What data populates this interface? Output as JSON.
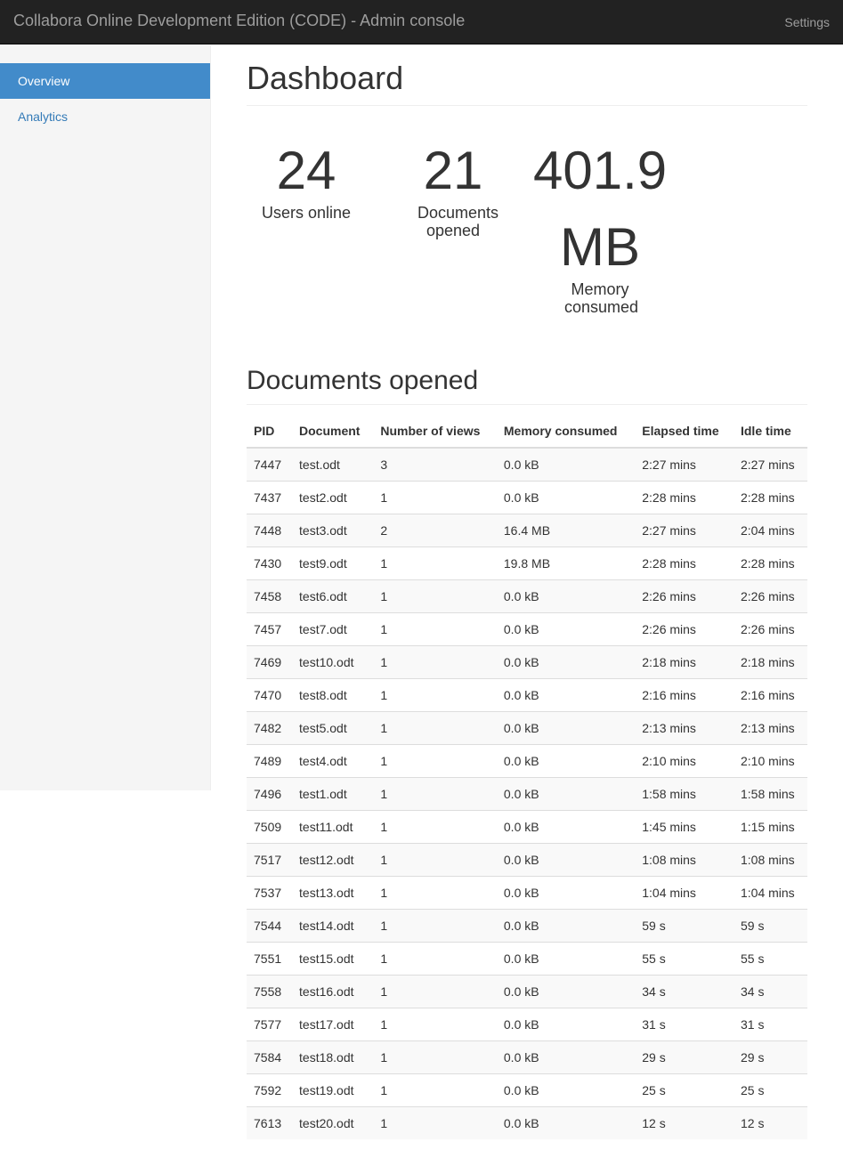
{
  "navbar": {
    "brand": "Collabora Online Development Edition (CODE) - Admin console",
    "settings": "Settings"
  },
  "sidebar": {
    "items": [
      {
        "label": "Overview",
        "active": true
      },
      {
        "label": "Analytics",
        "active": false
      }
    ]
  },
  "dashboard": {
    "title": "Dashboard",
    "stats": {
      "users_online": {
        "value": "24",
        "label": "Users online"
      },
      "documents_opened": {
        "value": "21",
        "label": "Documents opened"
      },
      "memory_consumed": {
        "value": "401.9 MB",
        "label": "Memory consumed"
      }
    }
  },
  "documents": {
    "title": "Documents opened",
    "columns": [
      "PID",
      "Document",
      "Number of views",
      "Memory consumed",
      "Elapsed time",
      "Idle time"
    ],
    "rows": [
      [
        "7447",
        "test.odt",
        "3",
        "0.0 kB",
        "2:27 mins",
        "2:27 mins"
      ],
      [
        "7437",
        "test2.odt",
        "1",
        "0.0 kB",
        "2:28 mins",
        "2:28 mins"
      ],
      [
        "7448",
        "test3.odt",
        "2",
        "16.4 MB",
        "2:27 mins",
        "2:04 mins"
      ],
      [
        "7430",
        "test9.odt",
        "1",
        "19.8 MB",
        "2:28 mins",
        "2:28 mins"
      ],
      [
        "7458",
        "test6.odt",
        "1",
        "0.0 kB",
        "2:26 mins",
        "2:26 mins"
      ],
      [
        "7457",
        "test7.odt",
        "1",
        "0.0 kB",
        "2:26 mins",
        "2:26 mins"
      ],
      [
        "7469",
        "test10.odt",
        "1",
        "0.0 kB",
        "2:18 mins",
        "2:18 mins"
      ],
      [
        "7470",
        "test8.odt",
        "1",
        "0.0 kB",
        "2:16 mins",
        "2:16 mins"
      ],
      [
        "7482",
        "test5.odt",
        "1",
        "0.0 kB",
        "2:13 mins",
        "2:13 mins"
      ],
      [
        "7489",
        "test4.odt",
        "1",
        "0.0 kB",
        "2:10 mins",
        "2:10 mins"
      ],
      [
        "7496",
        "test1.odt",
        "1",
        "0.0 kB",
        "1:58 mins",
        "1:58 mins"
      ],
      [
        "7509",
        "test11.odt",
        "1",
        "0.0 kB",
        "1:45 mins",
        "1:15 mins"
      ],
      [
        "7517",
        "test12.odt",
        "1",
        "0.0 kB",
        "1:08 mins",
        "1:08 mins"
      ],
      [
        "7537",
        "test13.odt",
        "1",
        "0.0 kB",
        "1:04 mins",
        "1:04 mins"
      ],
      [
        "7544",
        "test14.odt",
        "1",
        "0.0 kB",
        "59 s",
        "59 s"
      ],
      [
        "7551",
        "test15.odt",
        "1",
        "0.0 kB",
        "55 s",
        "55 s"
      ],
      [
        "7558",
        "test16.odt",
        "1",
        "0.0 kB",
        "34 s",
        "34 s"
      ],
      [
        "7577",
        "test17.odt",
        "1",
        "0.0 kB",
        "31 s",
        "31 s"
      ],
      [
        "7584",
        "test18.odt",
        "1",
        "0.0 kB",
        "29 s",
        "29 s"
      ],
      [
        "7592",
        "test19.odt",
        "1",
        "0.0 kB",
        "25 s",
        "25 s"
      ],
      [
        "7613",
        "test20.odt",
        "1",
        "0.0 kB",
        "12 s",
        "12 s"
      ]
    ]
  },
  "colors": {
    "navbar_bg": "#222222",
    "navbar_text": "#9d9d9d",
    "sidebar_bg": "#f5f5f5",
    "active_bg": "#428bca",
    "link": "#337ab7"
  }
}
